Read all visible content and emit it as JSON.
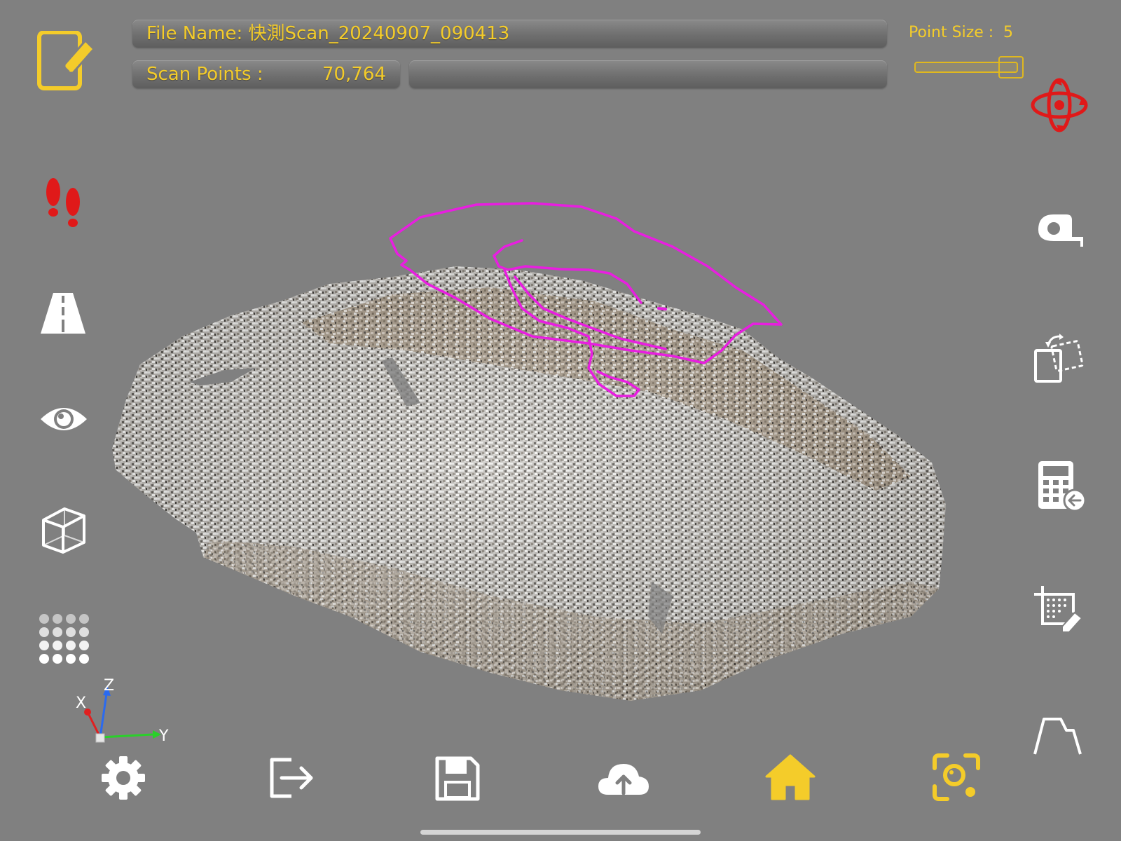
{
  "header": {
    "file_name_label": "File Name: 快測Scan_20240907_090413",
    "scan_points_label": "Scan Points :",
    "scan_points_value": "70,764",
    "status_text": "",
    "point_size_label": "Point Size :",
    "point_size_value": "5"
  },
  "point_size_slider": {
    "value": 5,
    "fraction": 0.92
  },
  "axes": {
    "x_label": "X",
    "y_label": "Y",
    "z_label": "Z"
  },
  "left_toolbar": [
    {
      "icon": "edit-icon"
    },
    {
      "icon": "footsteps-icon"
    },
    {
      "icon": "road-icon"
    },
    {
      "icon": "eye-icon"
    },
    {
      "icon": "cube-wireframe-icon"
    },
    {
      "icon": "point-grid-icon"
    }
  ],
  "right_toolbar": [
    {
      "icon": "orbit-rotate-icon"
    },
    {
      "icon": "tape-measure-icon"
    },
    {
      "icon": "transform-copy-icon"
    },
    {
      "icon": "calculator-icon"
    },
    {
      "icon": "crop-area-icon"
    },
    {
      "icon": "profile-section-icon"
    }
  ],
  "bottom_toolbar": [
    {
      "icon": "gear-icon"
    },
    {
      "icon": "exit-icon"
    },
    {
      "icon": "save-icon"
    },
    {
      "icon": "cloud-upload-icon"
    },
    {
      "icon": "home-icon"
    },
    {
      "icon": "scan-capture-icon"
    }
  ],
  "colors": {
    "background": "#808080",
    "accent_yellow": "#f4cc2a",
    "alert_red": "#e01919",
    "trace_magenta": "#e81ee0",
    "icon_white": "#ffffff"
  }
}
